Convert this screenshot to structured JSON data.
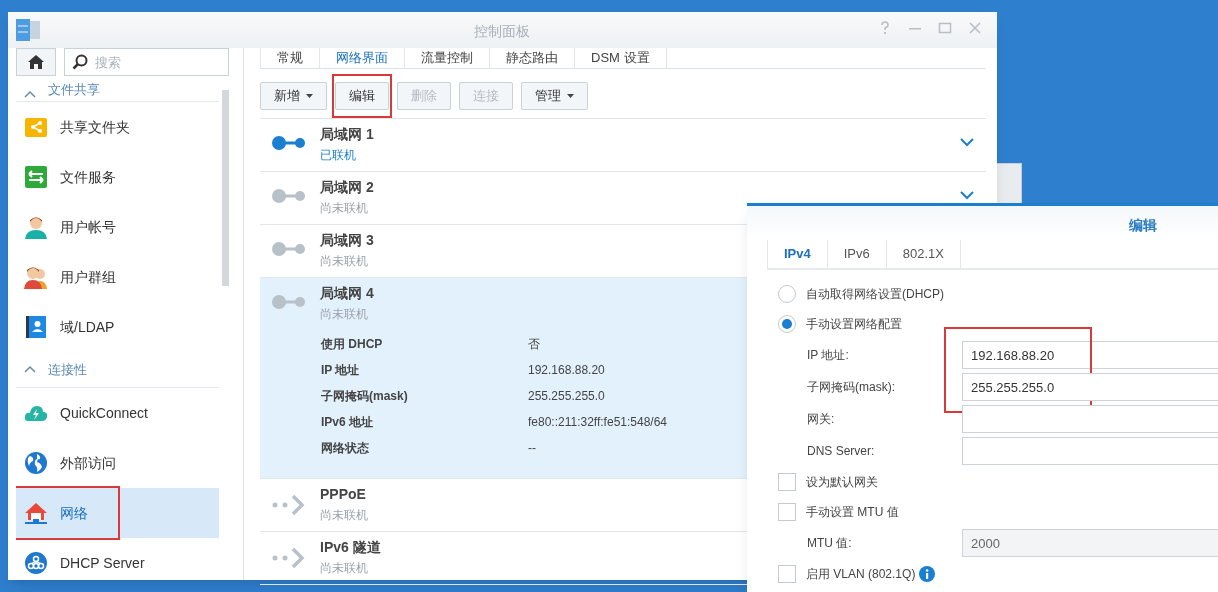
{
  "window": {
    "title": "控制面板"
  },
  "sidebar": {
    "search": {
      "placeholder": "搜索"
    },
    "items": [
      {
        "kind": "header",
        "label": "文件共享",
        "expanded": true
      },
      {
        "kind": "item",
        "label": "共享文件夹",
        "selected": false,
        "highlighted": false
      },
      {
        "kind": "item",
        "label": "文件服务",
        "selected": false,
        "highlighted": false
      },
      {
        "kind": "item",
        "label": "用户帐号",
        "selected": false,
        "highlighted": false
      },
      {
        "kind": "item",
        "label": "用户群组",
        "selected": false,
        "highlighted": false
      },
      {
        "kind": "item",
        "label": "域/LDAP",
        "selected": false,
        "highlighted": false
      },
      {
        "kind": "header",
        "label": "连接性",
        "expanded": true
      },
      {
        "kind": "item",
        "label": "QuickConnect",
        "selected": false,
        "highlighted": false
      },
      {
        "kind": "item",
        "label": "外部访问",
        "selected": false,
        "highlighted": false
      },
      {
        "kind": "item",
        "label": "网络",
        "selected": true,
        "highlighted": true
      },
      {
        "kind": "item",
        "label": "DHCP Server",
        "selected": false,
        "highlighted": false
      }
    ]
  },
  "tabs": [
    {
      "label": "常规",
      "selected": false
    },
    {
      "label": "网络界面",
      "selected": true
    },
    {
      "label": "流量控制",
      "selected": false
    },
    {
      "label": "静态路由",
      "selected": false
    },
    {
      "label": "DSM 设置",
      "selected": false
    }
  ],
  "toolbar": [
    {
      "label": "新增",
      "dropdown": true,
      "disabled": false,
      "highlighted": false
    },
    {
      "label": "编辑",
      "dropdown": false,
      "disabled": false,
      "highlighted": true
    },
    {
      "label": "删除",
      "dropdown": false,
      "disabled": true,
      "highlighted": false
    },
    {
      "label": "连接",
      "dropdown": false,
      "disabled": true,
      "highlighted": false
    },
    {
      "label": "管理",
      "dropdown": true,
      "disabled": false,
      "highlighted": false
    }
  ],
  "interfaces": [
    {
      "kind": "ethernet",
      "name": "局域网 1",
      "status": "已联机",
      "connected": true,
      "expanded": false,
      "toggle": true
    },
    {
      "kind": "ethernet",
      "name": "局域网 2",
      "status": "尚未联机",
      "connected": false,
      "expanded": false,
      "toggle": true
    },
    {
      "kind": "ethernet",
      "name": "局域网 3",
      "status": "尚未联机",
      "connected": false,
      "expanded": false
    },
    {
      "kind": "ethernet",
      "name": "局域网 4",
      "status": "尚未联机",
      "connected": false,
      "expanded": true,
      "details": [
        {
          "label": "使用 DHCP",
          "value": "否"
        },
        {
          "label": "IP 地址",
          "value": "192.168.88.20"
        },
        {
          "label": "子网掩码(mask)",
          "value": "255.255.255.0"
        },
        {
          "label": "IPv6 地址",
          "value": "fe80::211:32ff:fe51:548/64"
        },
        {
          "label": "网络状态",
          "value": "--"
        }
      ]
    },
    {
      "kind": "tunnel",
      "name": "PPPoE",
      "status": "尚未联机",
      "connected": false,
      "expanded": false
    },
    {
      "kind": "tunnel",
      "name": "IPv6 隧道",
      "status": "尚未联机",
      "connected": false,
      "expanded": false
    }
  ],
  "edit_dialog": {
    "title": "编辑",
    "tabs": [
      {
        "label": "IPv4",
        "selected": true
      },
      {
        "label": "IPv6",
        "selected": false
      },
      {
        "label": "802.1X",
        "selected": false
      }
    ],
    "rows": [
      {
        "kind": "radio",
        "label": "自动取得网络设置(DHCP)",
        "selected": false
      },
      {
        "kind": "radio",
        "label": "手动设置网络配置",
        "selected": true
      },
      {
        "kind": "field",
        "label": "IP 地址:",
        "value": "192.168.88.20",
        "highlighted": true,
        "disabled": false
      },
      {
        "kind": "field",
        "label": "子网掩码(mask):",
        "value": "255.255.255.0",
        "highlighted": true,
        "disabled": false
      },
      {
        "kind": "field",
        "label": "网关:",
        "highlighted": false,
        "disabled": false
      },
      {
        "kind": "field",
        "label": "DNS Server:",
        "highlighted": false,
        "disabled": false
      },
      {
        "kind": "checkbox",
        "label": "设为默认网关",
        "checked": false
      },
      {
        "kind": "checkbox",
        "label": "手动设置 MTU 值",
        "checked": false
      },
      {
        "kind": "field",
        "label": "MTU 值:",
        "value": "2000",
        "highlighted": false,
        "disabled": true
      },
      {
        "kind": "checkbox",
        "label": "启用 VLAN (802.1Q)",
        "checked": false,
        "info": true
      }
    ]
  }
}
